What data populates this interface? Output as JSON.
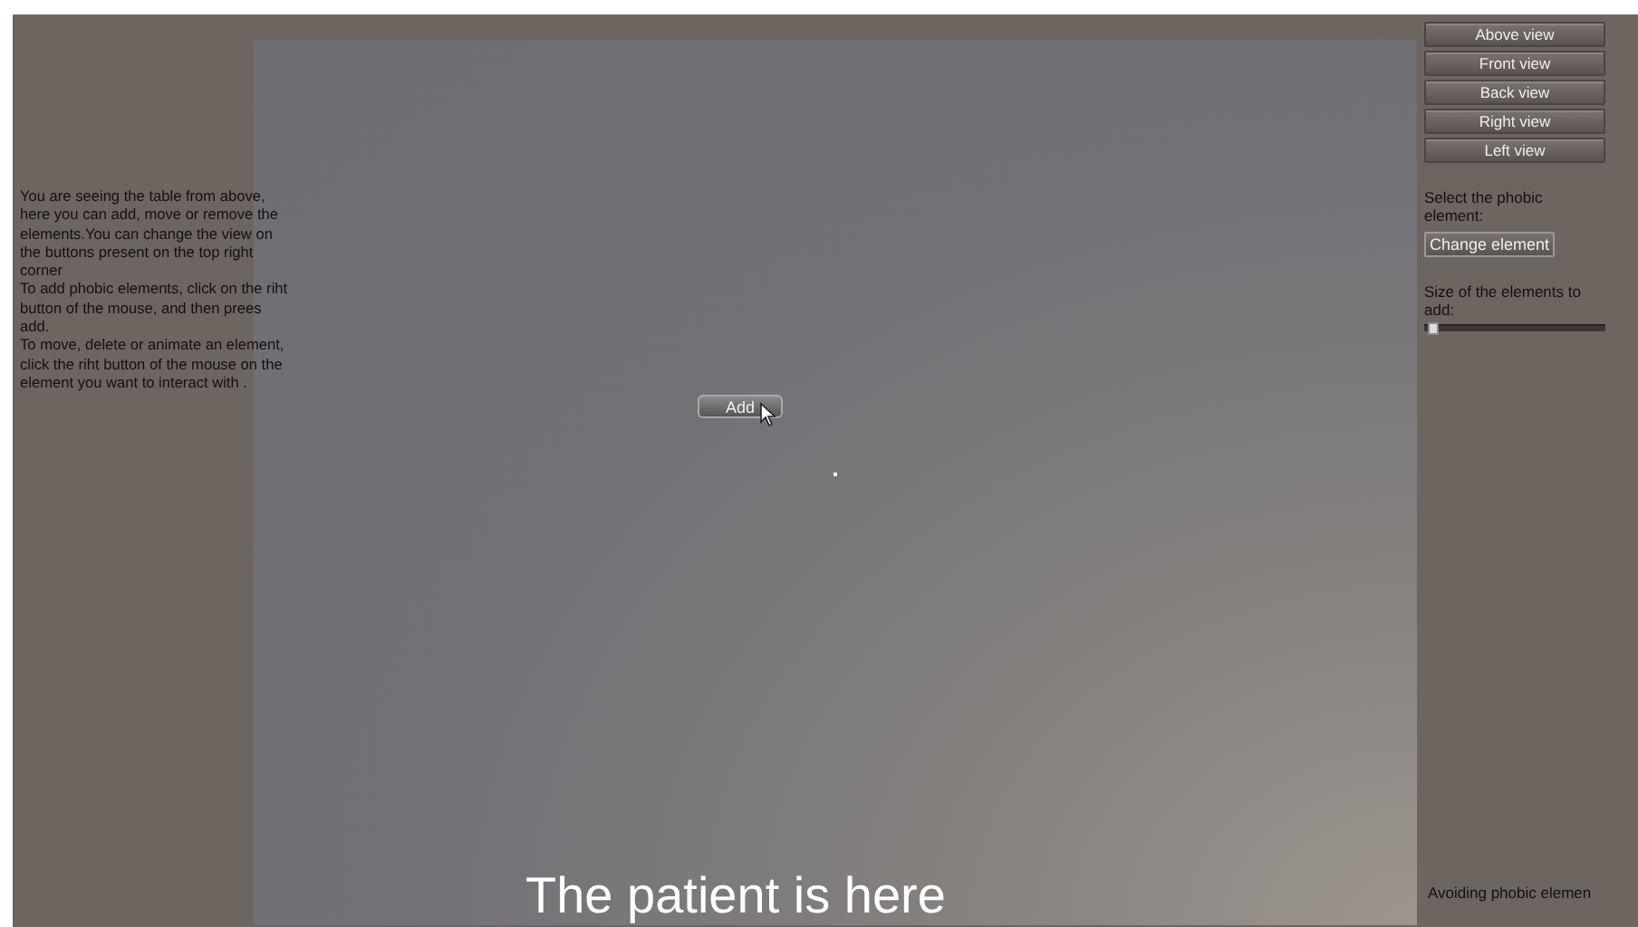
{
  "instructions": [
    "You are seeing the table from above, here you can add, move or remove the elements.You can change the view on the buttons present on the top right corner",
    "To add phobic elements, click on the riht button of the mouse, and then prees add.",
    "To move, delete or animate an element, click the riht button of the mouse on the element you want to interact with ."
  ],
  "table": {
    "add_button": "Add",
    "caption": "The patient is here"
  },
  "view_buttons": [
    "Above view",
    "Front view",
    "Back view",
    "Right view",
    "Left view"
  ],
  "element_select": {
    "label": "Select the phobic element:",
    "button": "Change element"
  },
  "size_slider": {
    "label": "Size of the elements to add:",
    "level": 0.02
  },
  "footer": "Avoiding phobic elemen"
}
